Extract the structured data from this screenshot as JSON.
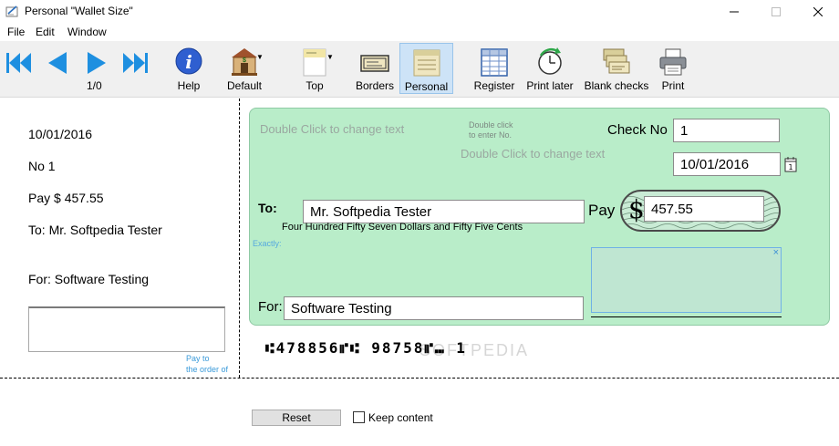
{
  "window": {
    "title": "Personal \"Wallet Size\""
  },
  "menu": [
    "File",
    "Edit",
    "Window"
  ],
  "toolbar": {
    "nav_counter": "1/0",
    "buttons": {
      "help": "Help",
      "default": "Default",
      "top": "Top",
      "borders": "Borders",
      "personal": "Personal",
      "register": "Register",
      "print_later": "Print later",
      "blank_checks": "Blank checks",
      "print": "Print"
    }
  },
  "stub": {
    "date": "10/01/2016",
    "number": "No 1",
    "pay": "Pay $ 457.55",
    "to": "To: Mr. Softpedia Tester",
    "for": "For: Software Testing",
    "payto_hint_1": "Pay to",
    "payto_hint_2": "the order of"
  },
  "check": {
    "hint_top_left": "Double Click to change text",
    "hint_enter_no_1": "Double click",
    "hint_enter_no_2": "to enter No.",
    "hint_center": "Double Click to change text",
    "check_no_label": "Check No",
    "check_no_value": "1",
    "date_value": "10/01/2016",
    "calendar_glyph": "1",
    "to_label": "To:",
    "payee": "Mr. Softpedia Tester",
    "pay_label": "Pay",
    "dollar_sign": "$",
    "amount": "457.55",
    "amount_words": "Four Hundred Fifty Seven Dollars and Fifty Five Cents",
    "exactly": "Exactly:",
    "memo_close": "×",
    "for_label": "For:",
    "memo_value": "Software Testing"
  },
  "micr_line": "⑆478856⑈⑆  98758⑈⑉    1",
  "watermark": "SOFTPEDIA",
  "footer": {
    "reset_label": "Reset",
    "keep_label": "Keep content"
  }
}
